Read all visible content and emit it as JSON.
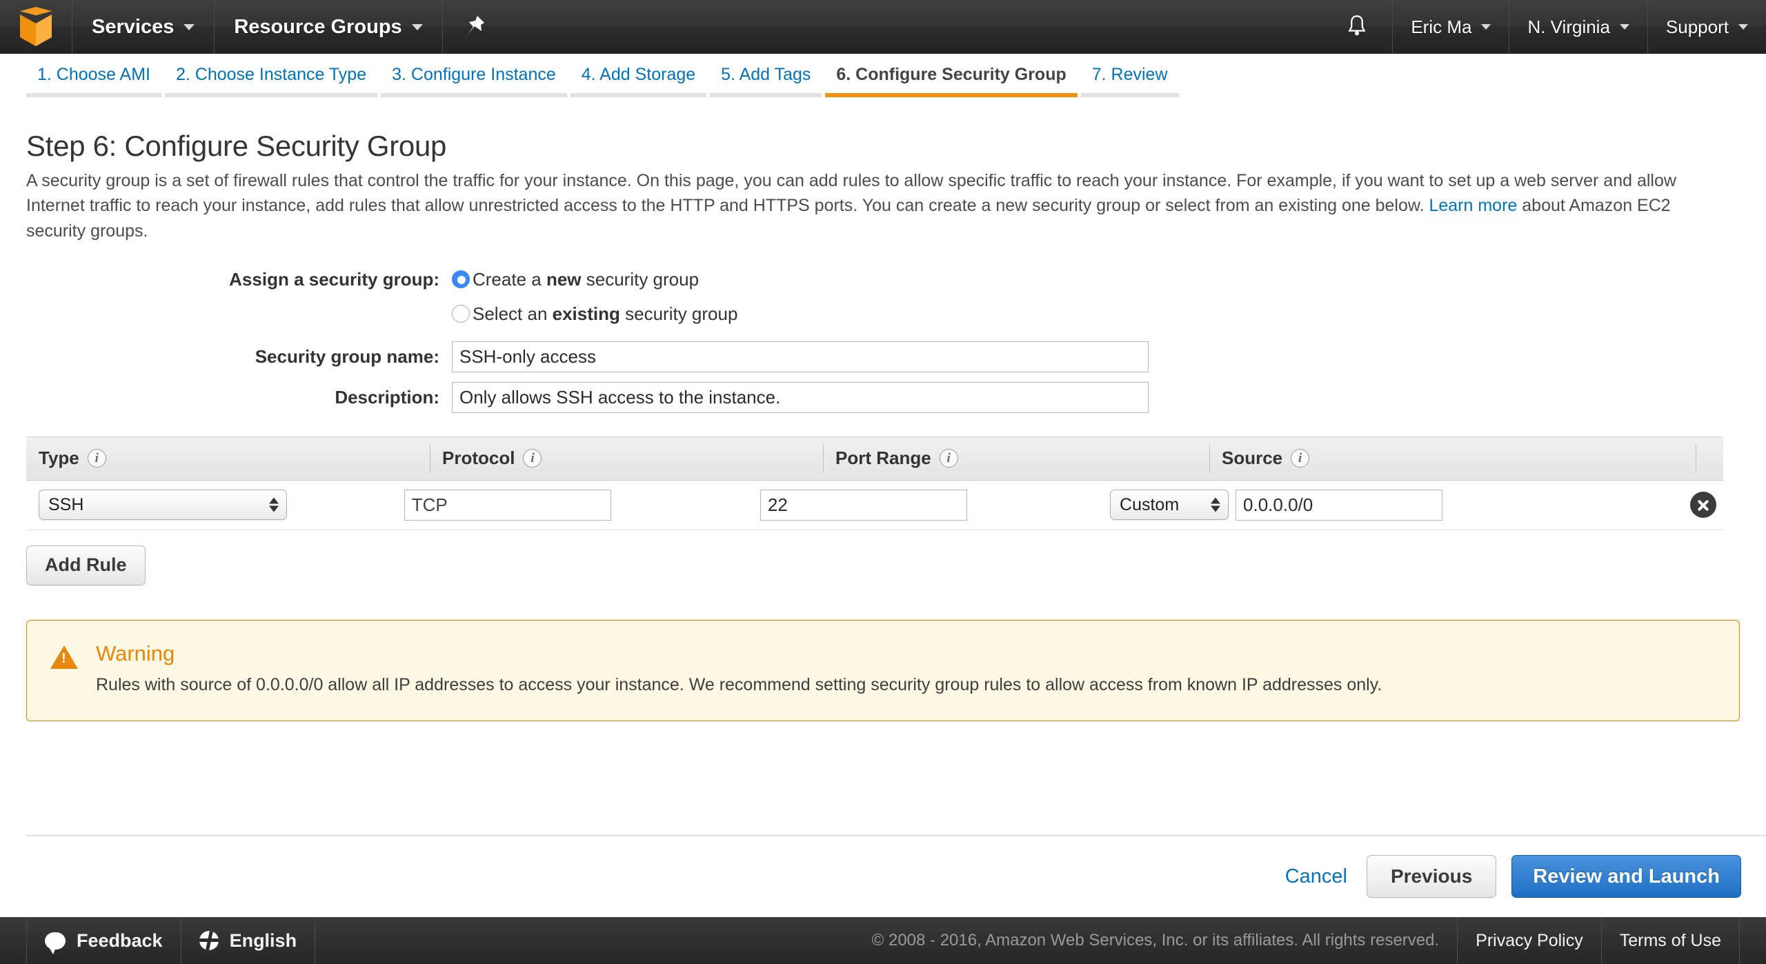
{
  "nav": {
    "logo_icon": "aws-cube-icon",
    "services_label": "Services",
    "resource_groups_label": "Resource Groups",
    "pin_icon": "pin-icon",
    "bell_icon": "bell-icon",
    "account_label": "Eric Ma",
    "region_label": "N. Virginia",
    "support_label": "Support"
  },
  "wizard": {
    "steps": [
      {
        "label": "1. Choose AMI",
        "active": false
      },
      {
        "label": "2. Choose Instance Type",
        "active": false
      },
      {
        "label": "3. Configure Instance",
        "active": false
      },
      {
        "label": "4. Add Storage",
        "active": false
      },
      {
        "label": "5. Add Tags",
        "active": false
      },
      {
        "label": "6. Configure Security Group",
        "active": true
      },
      {
        "label": "7. Review",
        "active": false
      }
    ],
    "active_color": "#f2910a",
    "link_color": "#0073bb"
  },
  "page": {
    "title": "Step 6: Configure Security Group",
    "description_part1": "A security group is a set of firewall rules that control the traffic for your instance. On this page, you can add rules to allow specific traffic to reach your instance. For example, if you want to set up a web server and allow Internet traffic to reach your instance, add rules that allow unrestricted access to the HTTP and HTTPS ports. You can create a new security group or select from an existing one below. ",
    "learn_more_label": "Learn more",
    "description_part2": " about Amazon EC2 security groups."
  },
  "form": {
    "assign_label": "Assign a security group:",
    "option_new_prefix": "Create a ",
    "option_new_bold": "new",
    "option_new_suffix": " security group",
    "option_new_selected": true,
    "option_existing_prefix": "Select an ",
    "option_existing_bold": "existing",
    "option_existing_suffix": " security group",
    "option_existing_selected": false,
    "name_label": "Security group name:",
    "name_value": "SSH-only access",
    "description_label": "Description:",
    "description_value": "Only allows SSH access to the instance."
  },
  "rules_table": {
    "columns": [
      {
        "label": "Type",
        "info_icon": "info-icon"
      },
      {
        "label": "Protocol",
        "info_icon": "info-icon"
      },
      {
        "label": "Port Range",
        "info_icon": "info-icon"
      },
      {
        "label": "Source",
        "info_icon": "info-icon"
      }
    ],
    "rows": [
      {
        "type": "SSH",
        "protocol": "TCP",
        "port_range": "22",
        "source_mode": "Custom",
        "source_value": "0.0.0.0/0",
        "delete_icon": "delete-circle-icon"
      }
    ],
    "add_rule_label": "Add Rule"
  },
  "warning": {
    "icon": "warning-triangle-icon",
    "title": "Warning",
    "body": "Rules with source of 0.0.0.0/0 allow all IP addresses to access your instance. We recommend setting security group rules to allow access from known IP addresses only.",
    "accent_color": "#e8870b",
    "background_color": "#fdf8e3"
  },
  "actions": {
    "cancel_label": "Cancel",
    "previous_label": "Previous",
    "review_launch_label": "Review and Launch"
  },
  "footer": {
    "feedback_icon": "speech-bubble-icon",
    "feedback_label": "Feedback",
    "language_icon": "globe-icon",
    "language_label": "English",
    "copyright": "© 2008 - 2016, Amazon Web Services, Inc. or its affiliates. All rights reserved.",
    "privacy_label": "Privacy Policy",
    "terms_label": "Terms of Use"
  }
}
